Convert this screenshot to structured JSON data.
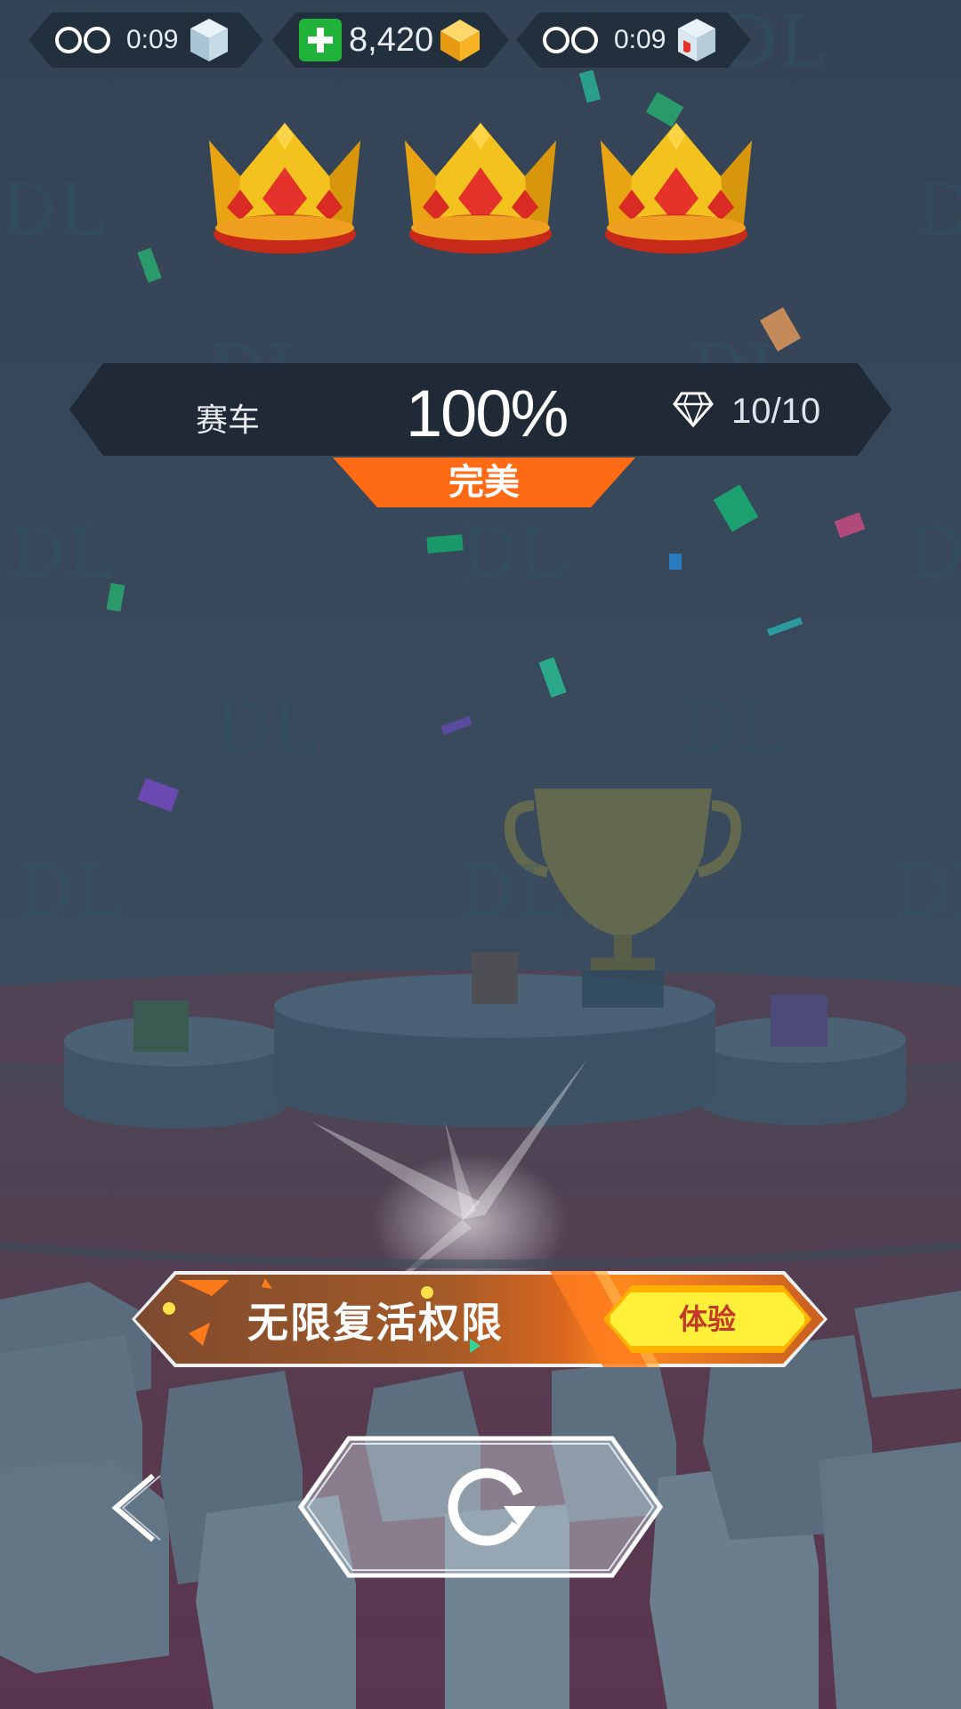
{
  "resources": [
    {
      "timer": "0:09",
      "icon": "ice-cube-icon"
    },
    {
      "value": "8,420",
      "icon": "gold-gem-icon"
    },
    {
      "timer": "0:09",
      "icon": "shield-cube-icon"
    }
  ],
  "crowns": {
    "earned": 3,
    "total": 3
  },
  "result": {
    "mode": "赛车",
    "percent": "100%",
    "gems": "10/10",
    "rating": "完美"
  },
  "promo": {
    "label": "无限复活权限",
    "button": "体验"
  },
  "watermark": "DL",
  "colors": {
    "accent": "#ff6a14",
    "button_yellow": "#fff03a",
    "gold": "#f4c21f"
  }
}
